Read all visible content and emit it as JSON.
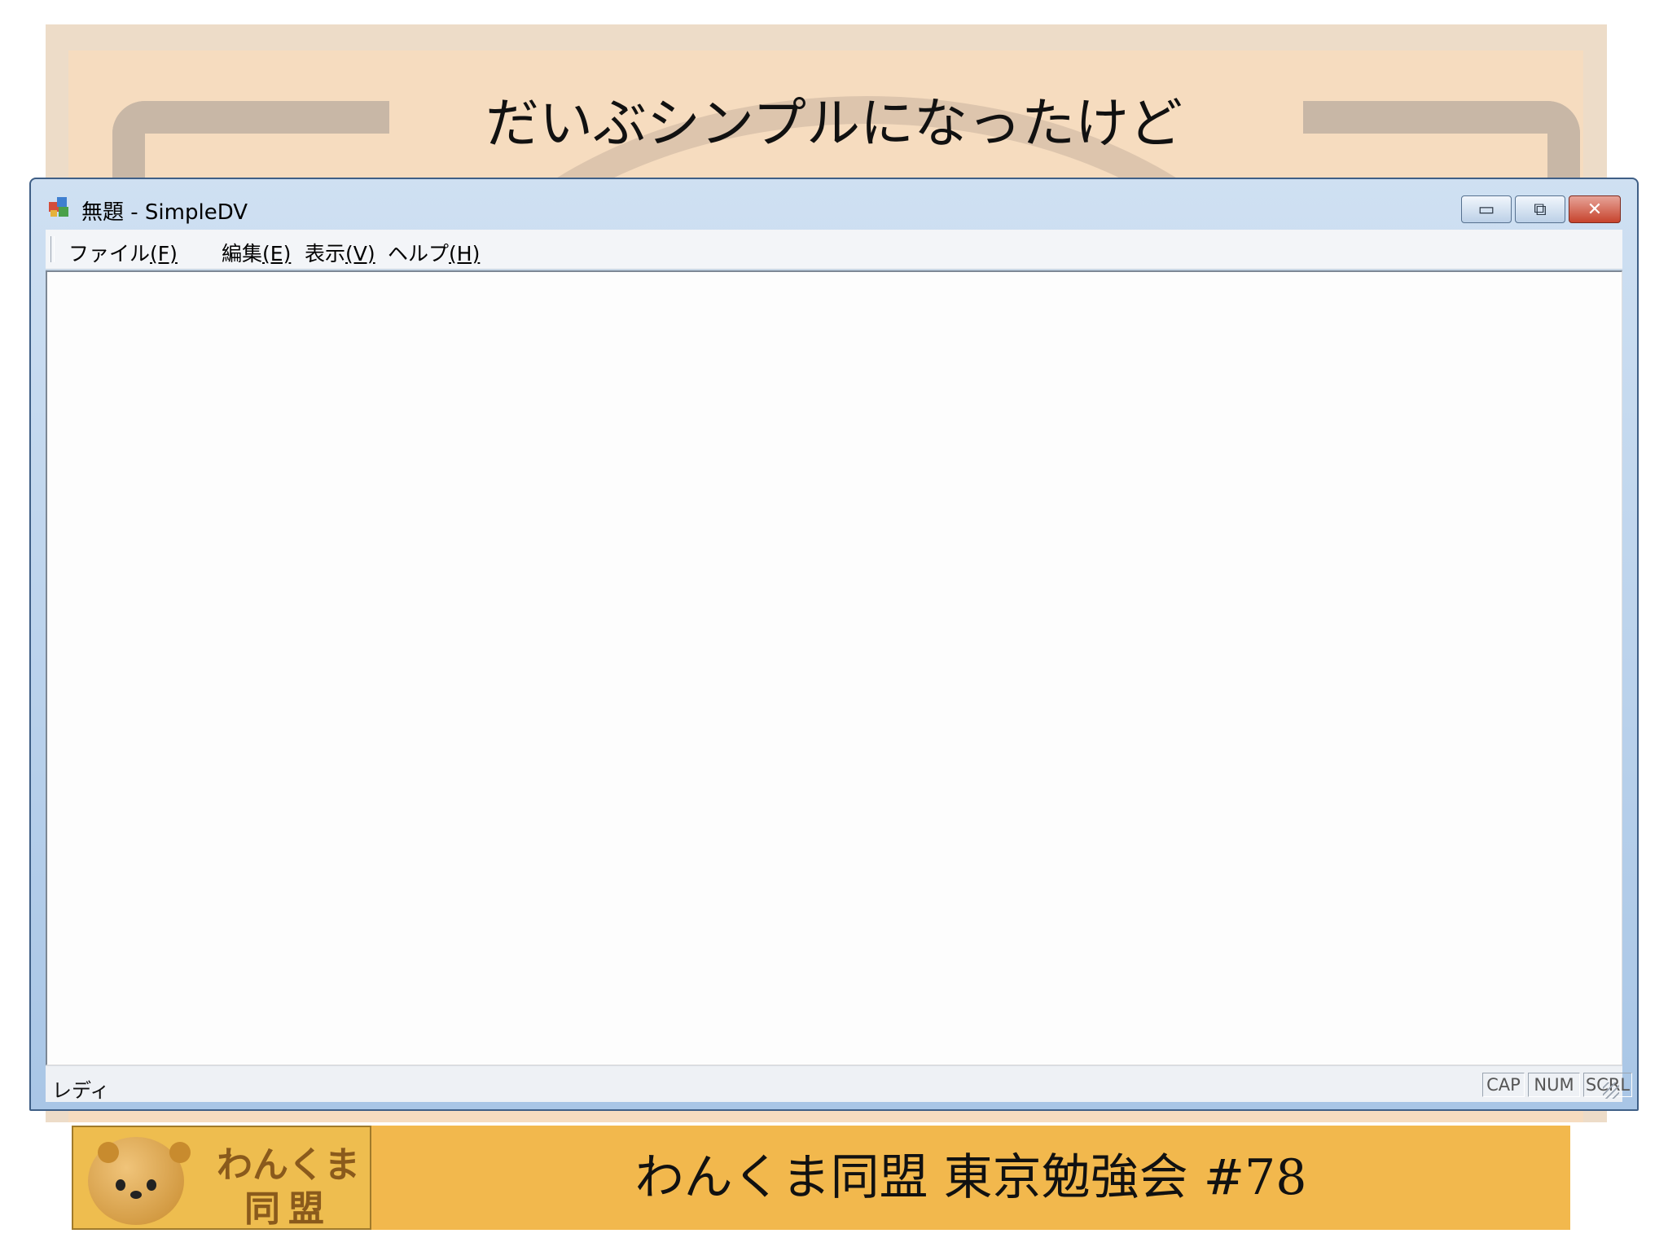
{
  "slide": {
    "title": "だいぶシンプルになったけど"
  },
  "window": {
    "title": "無題 - SimpleDV",
    "controls": {
      "minimize_glyph": "▭",
      "maximize_glyph": "⧉",
      "close_glyph": "✕"
    },
    "menu": [
      {
        "label": "ファイル",
        "accel": "(F)"
      },
      {
        "label": "編集",
        "accel": "(E)"
      },
      {
        "label": "表示",
        "accel": "(V)"
      },
      {
        "label": "ヘルプ",
        "accel": "(H)"
      }
    ],
    "status": {
      "text": "レディ",
      "cap": "CAP",
      "num": "NUM",
      "scrl": "SCRL"
    }
  },
  "footer": {
    "logo_line1": "わんくま",
    "logo_line2": "同盟",
    "text": "わんくま同盟 東京勉強会 #78"
  },
  "icons": {
    "app": "app-icon",
    "minimize": "minimize-icon",
    "maximize": "maximize-icon",
    "close": "close-icon",
    "logo": "bear-logo-icon"
  },
  "colors": {
    "footer_bg": "#f2b84d",
    "window_frame": "#a9c6e6",
    "close_button": "#c7432d"
  }
}
